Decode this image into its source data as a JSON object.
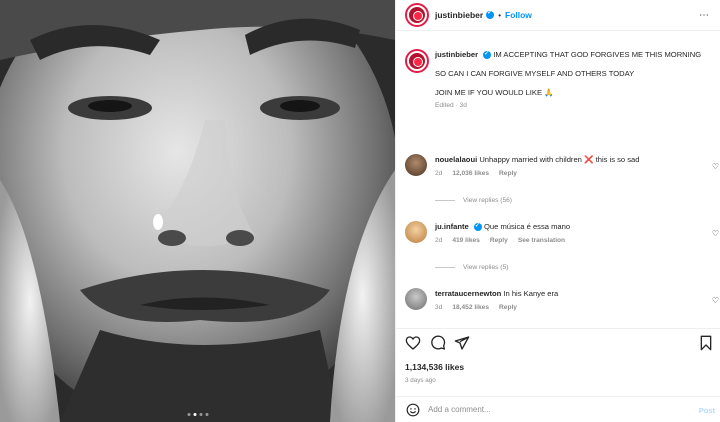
{
  "post": {
    "username": "justinbieber",
    "follow_label": "Follow",
    "separator": "•",
    "more_label": "⋯",
    "carousel_dots": 4,
    "active_dot": 2
  },
  "caption": {
    "username": "justinbieber",
    "line1": "IM ACCEPTING THAT GOD FORGIVES ME THIS MORNING",
    "line2": "SO CAN I CAN FORGIVE MYSELF AND OTHERS TODAY",
    "line3": "JOIN ME IF YOU WOULD LIKE",
    "emoji": "🙏",
    "meta": "Edited · 3d"
  },
  "comments": [
    {
      "username": "nouelalaoui",
      "text": "Unhappy married with children",
      "emoji": "❌",
      "text_tail": " this is so sad",
      "time": "2d",
      "likes": "12,036 likes",
      "reply": "Reply",
      "view_replies": "View replies (56)"
    },
    {
      "username": "ju.infante",
      "verified": true,
      "text": "Que música é essa mano",
      "time": "2d",
      "likes": "419 likes",
      "reply": "Reply",
      "see_translation": "See translation",
      "view_replies": "View replies (5)"
    },
    {
      "username": "terrataucernewton",
      "text": "In his Kanye era",
      "time": "3d",
      "likes": "18,452 likes",
      "reply": "Reply"
    }
  ],
  "stats": {
    "likes": "1,134,536 likes",
    "ago": "3 days ago"
  },
  "composer": {
    "placeholder": "Add a comment...",
    "post_label": "Post"
  },
  "icons": {
    "heart": "heart-icon",
    "comment": "comment-icon",
    "share": "share-icon",
    "save": "bookmark-icon",
    "emoji": "smile-icon"
  },
  "colors": {
    "accent": "#0095f6",
    "muted": "#8e8e8e",
    "text": "#262626",
    "post_disabled": "#b3dbff"
  }
}
